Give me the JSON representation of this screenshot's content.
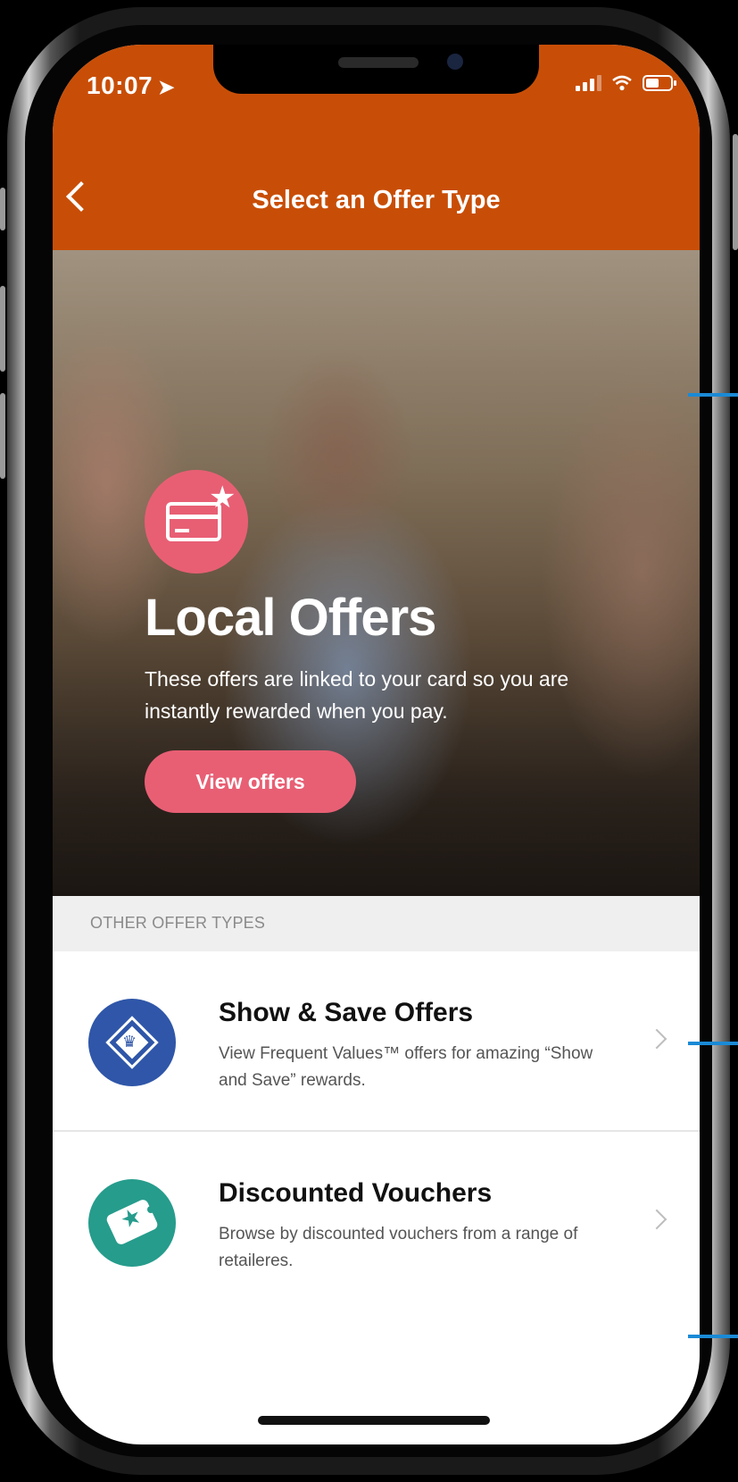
{
  "status_bar": {
    "time": "10:07",
    "location_arrow": "➤"
  },
  "header": {
    "back_icon": "chevron-left-icon",
    "title": "Select an Offer Type"
  },
  "hero": {
    "icon": "credit-card-star-icon",
    "title": "Local Offers",
    "description": "These offers are linked to your card so you are instantly rewarded when you pay.",
    "button_label": "View offers"
  },
  "section": {
    "header": "OTHER OFFER TYPES"
  },
  "offers": [
    {
      "icon": "crown-diamond-icon",
      "icon_color": "#2f56a8",
      "title": "Show & Save Offers",
      "description": "View Frequent Values™  offers for amazing “Show and Save” rewards."
    },
    {
      "icon": "star-tag-icon",
      "icon_color": "#269c8c",
      "title": "Discounted Vouchers",
      "description": "Browse by discounted vouchers from a range of retaileres."
    }
  ],
  "colors": {
    "header_bg": "#c84e07",
    "accent_pink": "#e85f74",
    "guide_blue": "#1a8ad6"
  }
}
